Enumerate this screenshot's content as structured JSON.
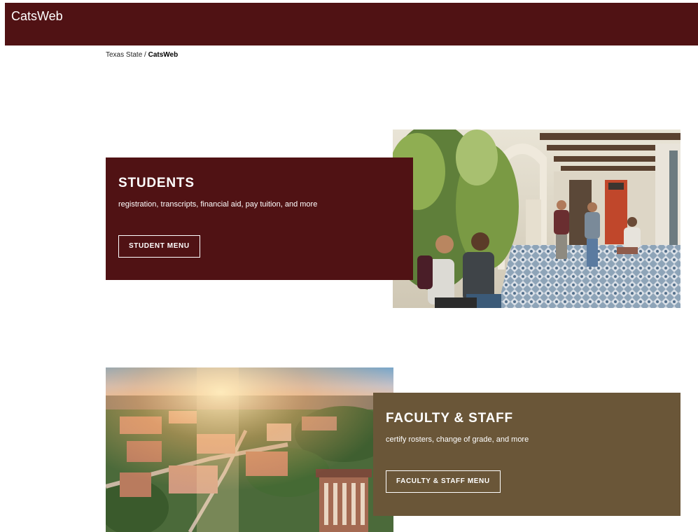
{
  "header": {
    "title": "CatsWeb"
  },
  "breadcrumb": {
    "parent": "Texas State",
    "separator": " / ",
    "current": "CatsWeb"
  },
  "students": {
    "heading": "STUDENTS",
    "description": "registration, transcripts, financial aid, pay tuition, and more",
    "button_label": "STUDENT MENU"
  },
  "faculty": {
    "heading": "FACULTY & STAFF",
    "description": "certify rosters, change of grade, and more",
    "button_label": "FACULTY & STAFF MENU"
  },
  "colors": {
    "maroon": "#501214",
    "gold_brown": "#6a5638"
  }
}
